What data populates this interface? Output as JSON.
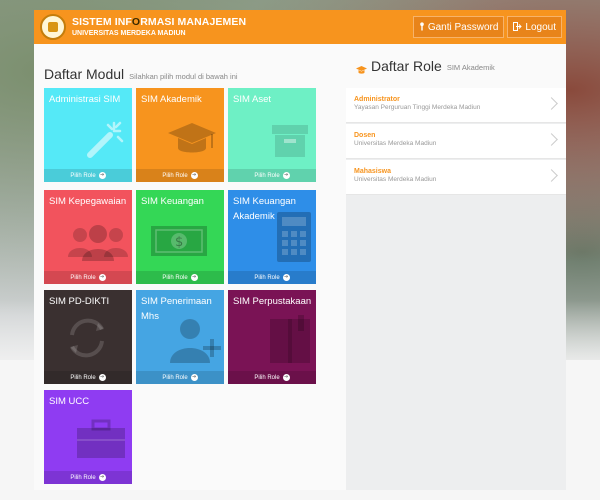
{
  "header": {
    "title_part1": "SISTEM INF",
    "title_accent": "O",
    "title_part2": "RMASI MANAJEMEN",
    "subtitle": "UNIVERSITAS MERDEKA MADIUN",
    "change_password": "Ganti Password",
    "logout": "Logout"
  },
  "modules": {
    "title": "Daftar Modul",
    "subtitle": "Silahkan pilih modul di bawah ini",
    "footer_label": "Pilih Role",
    "tiles": [
      {
        "label": "Administrasi SIM",
        "color": "#55e9f7",
        "icon": "magic-wand-icon"
      },
      {
        "label": "SIM Akademik",
        "color": "#f7941e",
        "icon": "graduation-cap-icon"
      },
      {
        "label": "SIM Aset",
        "color": "#6ef0c5",
        "icon": "archive-box-icon"
      },
      {
        "label": "SIM Kepegawaian",
        "color": "#f2535d",
        "icon": "users-icon"
      },
      {
        "label": "SIM Keuangan",
        "color": "#34d756",
        "icon": "money-icon"
      },
      {
        "label": "SIM Keuangan Akademik",
        "color": "#2e8ee8",
        "icon": "calculator-icon"
      },
      {
        "label": "SIM PD-DIKTI",
        "color": "#3a3030",
        "icon": "refresh-icon"
      },
      {
        "label": "SIM Penerimaan Mhs",
        "color": "#45a5e3",
        "icon": "add-user-icon"
      },
      {
        "label": "SIM Perpustakaan",
        "color": "#7a1355",
        "icon": "book-icon"
      },
      {
        "label": "SIM UCC",
        "color": "#8f3cf2",
        "icon": "briefcase-icon"
      }
    ]
  },
  "roles": {
    "title": "Daftar Role",
    "subtitle": "SIM Akademik",
    "items": [
      {
        "name": "Administrator",
        "org": "Yayasan Perguruan Tinggi Merdeka Madiun"
      },
      {
        "name": "Dosen",
        "org": "Universitas Merdeka Madiun"
      },
      {
        "name": "Mahasiswa",
        "org": "Universitas Merdeka Madiun"
      }
    ]
  }
}
